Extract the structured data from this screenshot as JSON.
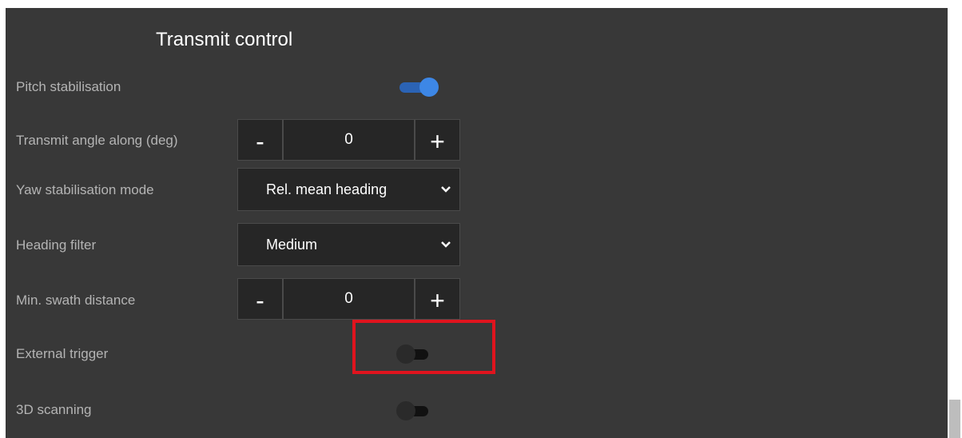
{
  "panel": {
    "title": "Transmit control",
    "rows": {
      "pitch_stabilisation": {
        "label": "Pitch stabilisation",
        "toggle": "on"
      },
      "transmit_angle_along": {
        "label": "Transmit angle along (deg)",
        "minus": "-",
        "value": "0",
        "plus": "+"
      },
      "yaw_stabilisation_mode": {
        "label": "Yaw stabilisation mode",
        "selected": "Rel. mean heading"
      },
      "heading_filter": {
        "label": "Heading filter",
        "selected": "Medium"
      },
      "min_swath_distance": {
        "label": "Min. swath distance",
        "minus": "-",
        "value": "0",
        "plus": "+"
      },
      "external_trigger": {
        "label": "External trigger",
        "toggle": "off"
      },
      "scanning_3d": {
        "label": "3D scanning",
        "toggle": "off"
      }
    }
  },
  "icons": {
    "select_arrow": "chevron-down-icon"
  },
  "colors": {
    "panel_bg": "#383838",
    "toggle_on": "#3d87e6",
    "highlight": "#e0141e"
  }
}
